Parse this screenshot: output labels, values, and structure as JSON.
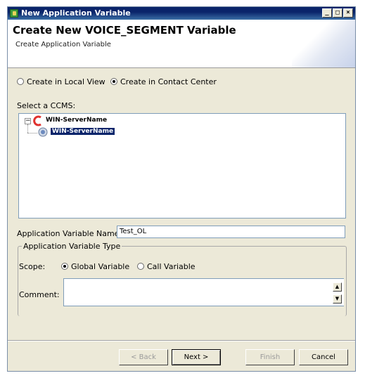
{
  "window": {
    "title": "New Application Variable",
    "controls": {
      "minimize": "_",
      "maximize": "□",
      "close": "×"
    }
  },
  "header": {
    "title": "Create New VOICE_SEGMENT Variable",
    "subtitle": "Create Application Variable"
  },
  "location": {
    "options": [
      {
        "label": "Create in Local View",
        "selected": false
      },
      {
        "label": "Create in Contact Center",
        "selected": true
      }
    ]
  },
  "ccms": {
    "label": "Select a CCMS:",
    "tree": {
      "root": {
        "label": "WIN-ServerName",
        "expander": "−"
      },
      "child": {
        "label": "WIN-ServerName",
        "selected": true
      }
    }
  },
  "variable_name": {
    "label": "Application Variable Name:",
    "value": "Test_OL"
  },
  "variable_type": {
    "legend": "Application Variable Type",
    "scope_label": "Scope:",
    "scope_options": [
      {
        "label": "Global Variable",
        "selected": true
      },
      {
        "label": "Call Variable",
        "selected": false
      }
    ],
    "comment_label": "Comment:",
    "comment_value": ""
  },
  "buttons": {
    "back": "< Back",
    "next": "Next >",
    "finish": "Finish",
    "cancel": "Cancel"
  },
  "colors": {
    "titlebar": "#0a246a",
    "selection": "#0a246a",
    "ccms_icon": "#e0312e",
    "dialog_bg": "#ece9d8"
  },
  "icons": {
    "app": "app-icon",
    "ccms_root": "ccms-c-icon",
    "server": "server-icon"
  }
}
